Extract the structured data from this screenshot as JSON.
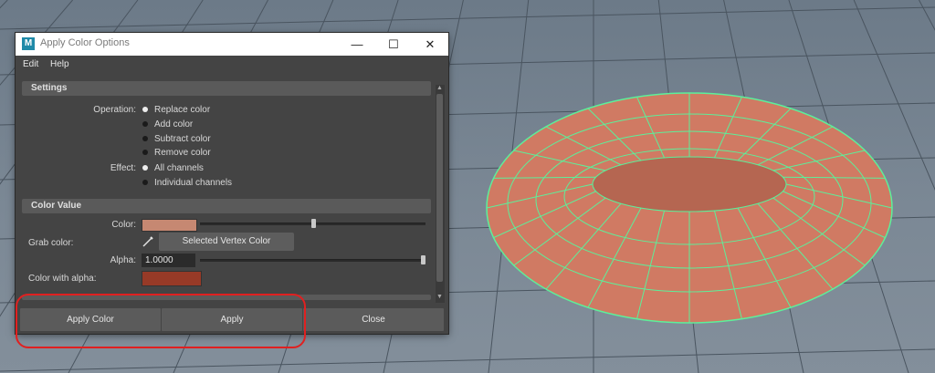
{
  "window": {
    "title": "Apply Color Options",
    "icon_letter": "M"
  },
  "menu": {
    "items": [
      "Edit",
      "Help"
    ]
  },
  "settings": {
    "header": "Settings",
    "operation_label": "Operation:",
    "operations": [
      "Replace color",
      "Add color",
      "Subtract color",
      "Remove color"
    ],
    "operation_selected": "Replace color",
    "effect_label": "Effect:",
    "effects": [
      "All channels",
      "Individual channels"
    ],
    "effect_selected": "All channels"
  },
  "color_value": {
    "header": "Color Value",
    "color_label": "Color:",
    "color_hex": "#c68872",
    "color_slider_fraction": 0.5,
    "grab_label": "Grab color:",
    "grab_button": "Selected Vertex Color",
    "alpha_label": "Alpha:",
    "alpha_value": "1.0000",
    "alpha_slider_fraction": 1.0,
    "color_with_alpha_label": "Color with alpha:",
    "color_with_alpha_hex": "#973a27"
  },
  "buttons": {
    "apply_color": "Apply Color",
    "apply": "Apply",
    "close": "Close"
  },
  "colors": {
    "dialog_bg": "#444444",
    "torus_fill": "#d07a63",
    "torus_wire": "#5cf09a",
    "highlight": "#e02020"
  }
}
